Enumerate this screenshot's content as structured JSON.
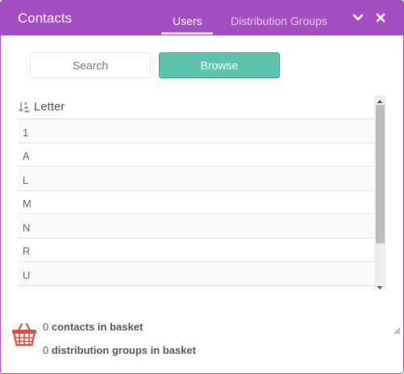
{
  "header": {
    "title": "Contacts",
    "tabs": [
      {
        "label": "Users",
        "active": true
      },
      {
        "label": "Distribution Groups",
        "active": false
      }
    ],
    "collapse_icon": "chevron-down-icon",
    "close_icon": "close-icon",
    "color": "#a54ec2"
  },
  "modes": {
    "search_label": "Search",
    "browse_label": "Browse",
    "active": "Browse",
    "browse_color": "#5ec3ac"
  },
  "list": {
    "column_header": "Letter",
    "sort_icon": "sort-descending-icon",
    "rows": [
      "1",
      "A",
      "L",
      "M",
      "N",
      "R",
      "U"
    ]
  },
  "basket": {
    "icon": "basket-icon",
    "contacts_count": "0",
    "contacts_text": "contacts in basket",
    "groups_count": "0",
    "groups_text": "distribution groups in basket",
    "icon_color": "#e0493c"
  }
}
